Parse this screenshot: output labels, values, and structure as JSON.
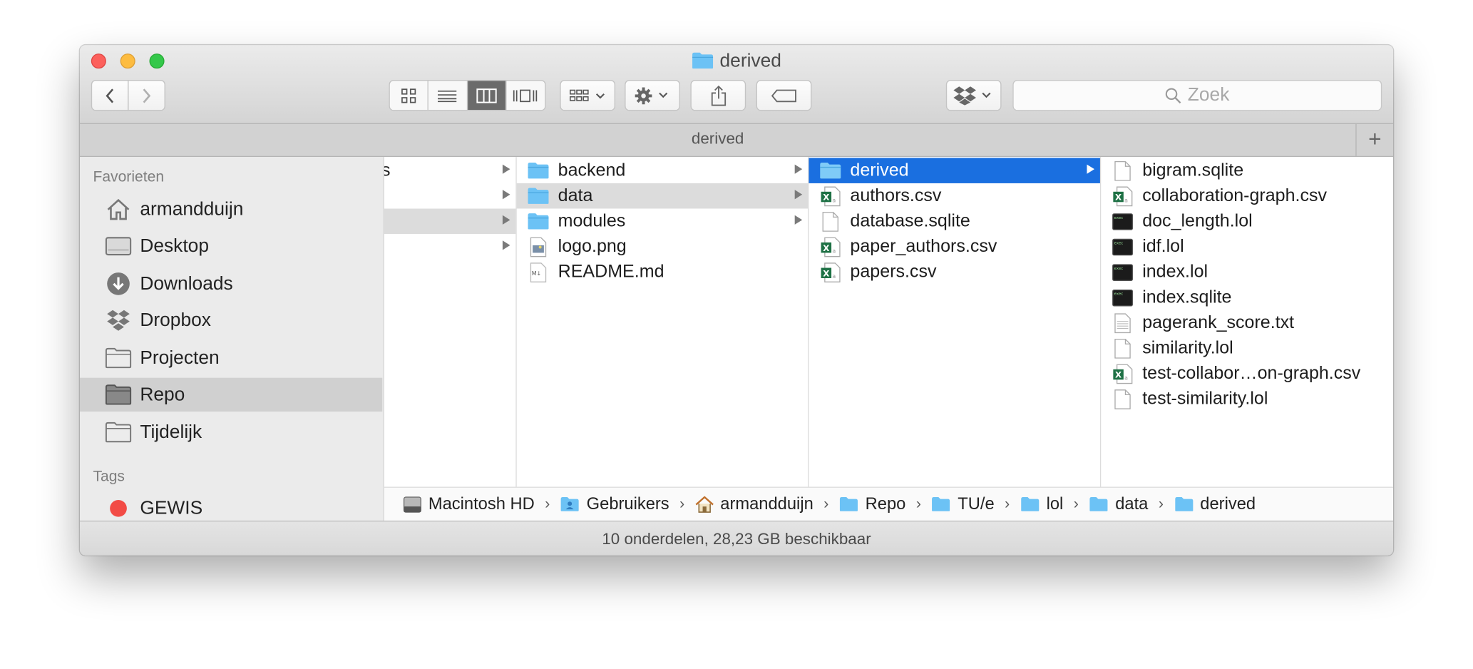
{
  "window": {
    "title": "derived"
  },
  "toolbar": {
    "back_icon": "chevron-left-icon",
    "forward_icon": "chevron-right-icon",
    "view_modes": [
      "icon-view-icon",
      "list-view-icon",
      "column-view-icon",
      "cover-flow-icon"
    ],
    "active_view": "column",
    "search_placeholder": "Zoek"
  },
  "tabbar": {
    "title": "derived",
    "add_label": "+"
  },
  "sidebar": {
    "favorites_heading": "Favorieten",
    "items": [
      {
        "label": "armandduijn",
        "icon": "home-icon"
      },
      {
        "label": "Desktop",
        "icon": "desktop-icon"
      },
      {
        "label": "Downloads",
        "icon": "downloads-icon"
      },
      {
        "label": "Dropbox",
        "icon": "dropbox-icon"
      },
      {
        "label": "Projecten",
        "icon": "folder-icon"
      },
      {
        "label": "Repo",
        "icon": "folder-icon",
        "selected": true
      },
      {
        "label": "Tijdelijk",
        "icon": "folder-icon"
      }
    ],
    "tags_heading": "Tags",
    "tags": [
      {
        "label": "GEWIS",
        "color": "#f24b45"
      }
    ]
  },
  "columns": {
    "col1": {
      "partial_text": "s"
    },
    "col2": [
      {
        "name": "backend",
        "type": "folder"
      },
      {
        "name": "data",
        "type": "folder",
        "state": "grey"
      },
      {
        "name": "modules",
        "type": "folder"
      },
      {
        "name": "logo.png",
        "type": "image"
      },
      {
        "name": "README.md",
        "type": "markdown"
      }
    ],
    "col3": [
      {
        "name": "derived",
        "type": "folder",
        "state": "selected"
      },
      {
        "name": "authors.csv",
        "type": "csv"
      },
      {
        "name": "database.sqlite",
        "type": "doc"
      },
      {
        "name": "paper_authors.csv",
        "type": "csv"
      },
      {
        "name": "papers.csv",
        "type": "csv"
      }
    ],
    "col4": [
      {
        "name": "bigram.sqlite",
        "type": "doc"
      },
      {
        "name": "collaboration-graph.csv",
        "type": "csv"
      },
      {
        "name": "doc_length.lol",
        "type": "exec"
      },
      {
        "name": "idf.lol",
        "type": "exec"
      },
      {
        "name": "index.lol",
        "type": "exec"
      },
      {
        "name": "index.sqlite",
        "type": "exec"
      },
      {
        "name": "pagerank_score.txt",
        "type": "text"
      },
      {
        "name": "similarity.lol",
        "type": "doc"
      },
      {
        "name": "test-collabor…on-graph.csv",
        "type": "csv"
      },
      {
        "name": "test-similarity.lol",
        "type": "doc"
      }
    ]
  },
  "pathbar": {
    "crumbs": [
      {
        "label": "Macintosh HD",
        "icon": "hard-drive-icon"
      },
      {
        "label": "Gebruikers",
        "icon": "users-folder-icon"
      },
      {
        "label": "armandduijn",
        "icon": "home-icon"
      },
      {
        "label": "Repo",
        "icon": "folder-icon"
      },
      {
        "label": "TU/e",
        "icon": "folder-icon"
      },
      {
        "label": "lol",
        "icon": "folder-icon"
      },
      {
        "label": "data",
        "icon": "folder-icon"
      },
      {
        "label": "derived",
        "icon": "folder-icon"
      }
    ],
    "separator": "›"
  },
  "status": {
    "text": "10 onderdelen, 28,23 GB beschikbaar"
  },
  "colors": {
    "selection": "#1a6fe0",
    "folder": "#6cc2f5",
    "csv_green": "#1e7145"
  }
}
